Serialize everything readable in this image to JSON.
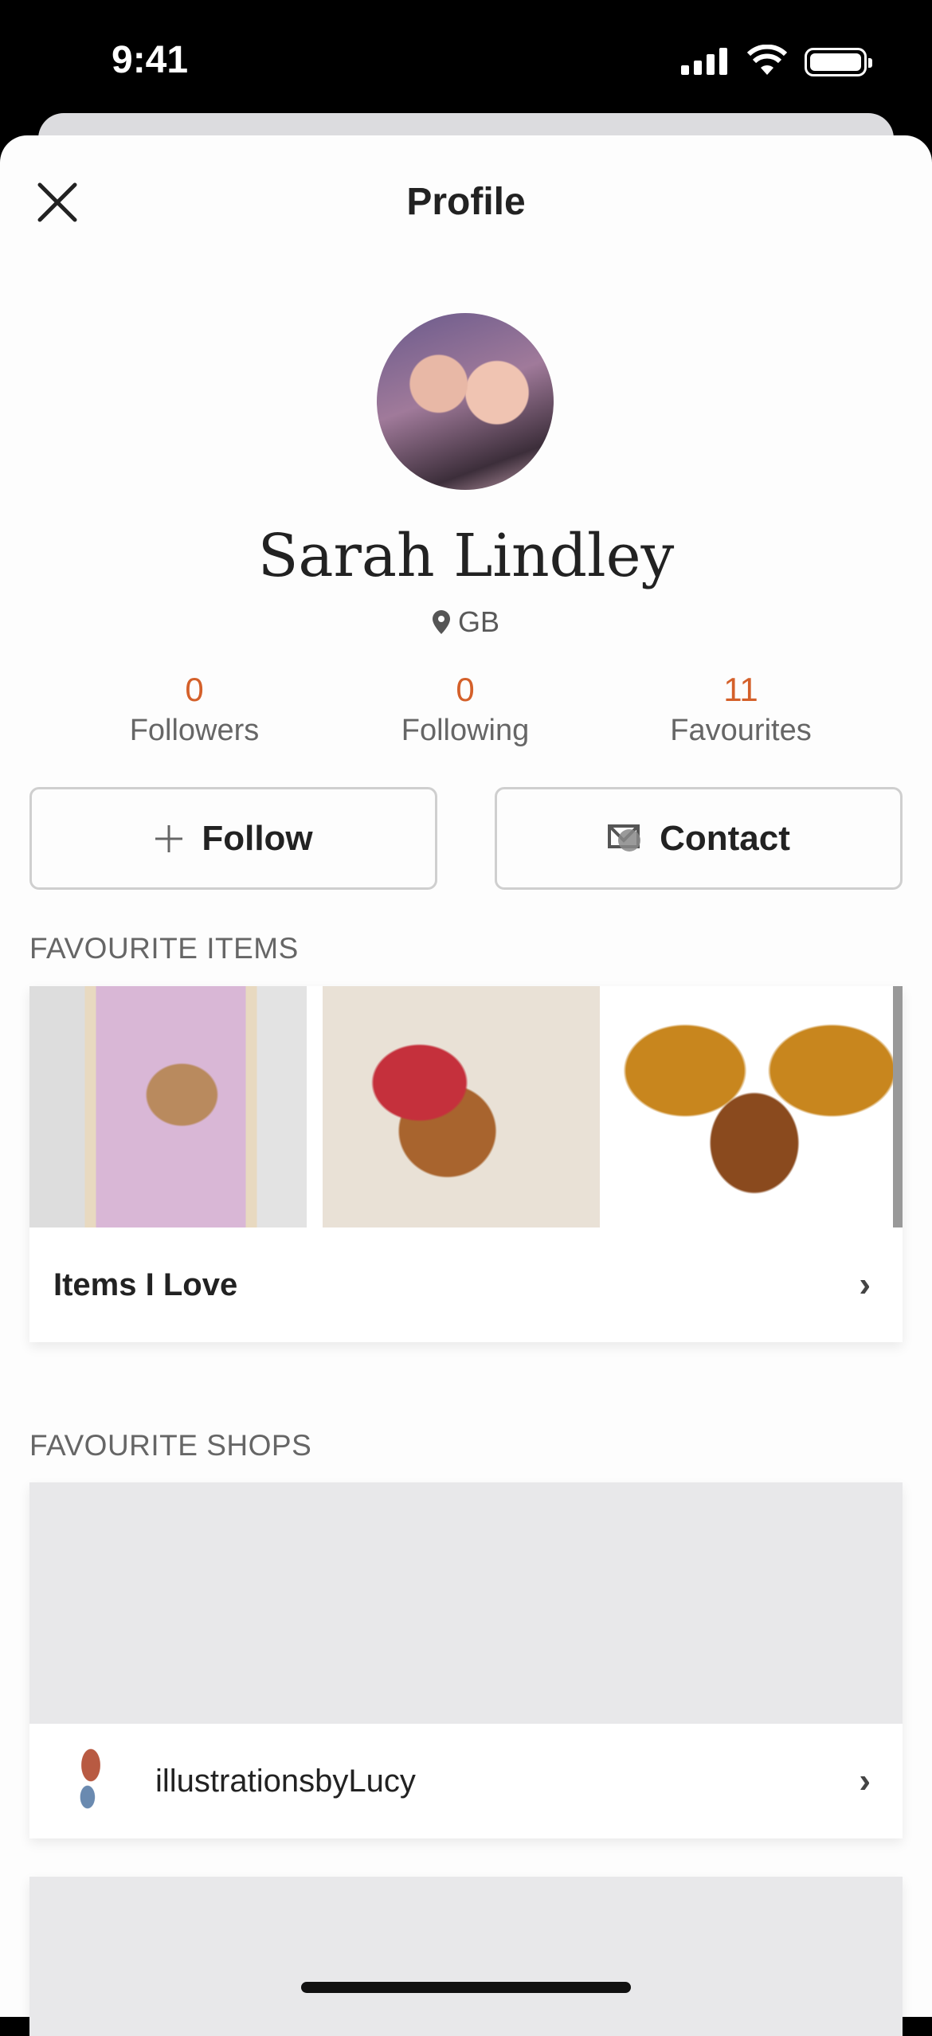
{
  "status_bar": {
    "time": "9:41"
  },
  "header": {
    "title": "Profile",
    "close_icon": "close-icon"
  },
  "profile": {
    "name": "Sarah Lindley",
    "location": "GB",
    "location_icon": "map-pin-icon"
  },
  "stats": [
    {
      "value": "0",
      "label": "Followers"
    },
    {
      "value": "0",
      "label": "Following"
    },
    {
      "value": "11",
      "label": "Favourites"
    }
  ],
  "actions": {
    "follow": "Follow",
    "contact": "Contact"
  },
  "favourite_items": {
    "heading": "FAVOURITE ITEMS",
    "list_title": "Items I Love"
  },
  "favourite_shops": {
    "heading": "FAVOURITE SHOPS",
    "shops": [
      {
        "name": "illustrationsbyLucy"
      }
    ]
  },
  "colors": {
    "accent": "#d4602a"
  }
}
